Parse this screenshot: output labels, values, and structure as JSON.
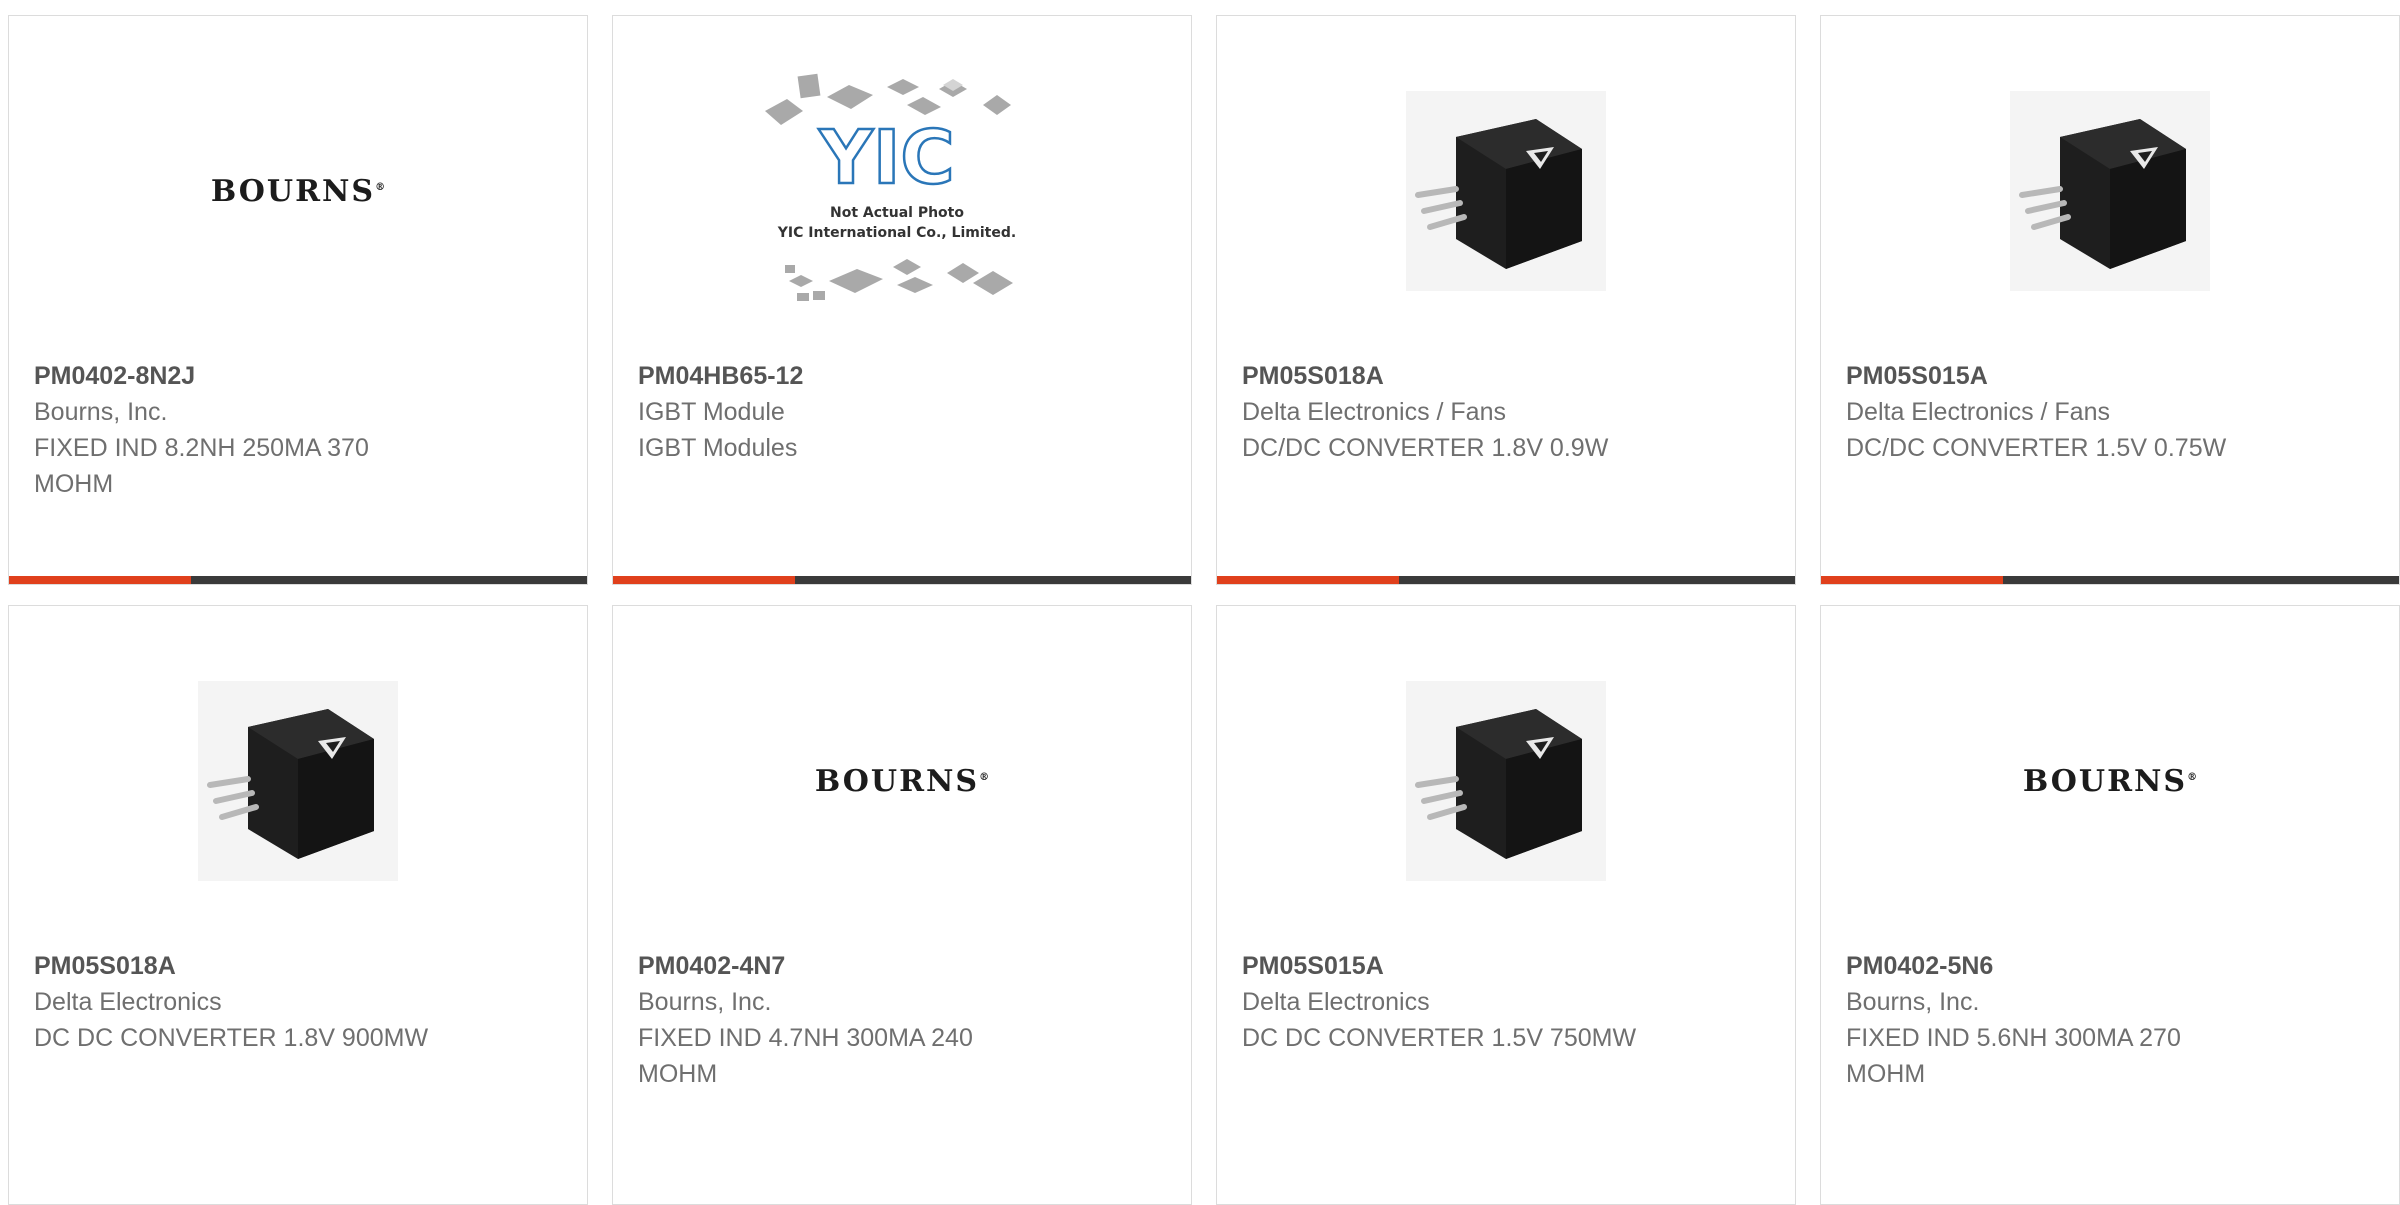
{
  "colors": {
    "accent": "#e0401c",
    "bar": "#3a3a3a",
    "part_text": "#555555",
    "body_text": "#6f6f6f"
  },
  "products": [
    {
      "part": "PM0402-8N2J",
      "maker": "Bourns, Inc.",
      "description": "FIXED IND 8.2NH 250MA 370 MOHM",
      "image": "bourns-logo",
      "logo_text": "BOURNS"
    },
    {
      "part": "PM04HB65-12",
      "maker": "IGBT Module",
      "description": "IGBT Modules",
      "image": "not-actual-photo",
      "placeholder_line1": "Not Actual Photo",
      "placeholder_line2": "YIC International Co., Limited.",
      "placeholder_logo": "YIC"
    },
    {
      "part": "PM05S018A",
      "maker": "Delta Electronics / Fans",
      "description": "DC/DC CONVERTER 1.8V 0.9W",
      "image": "converter-photo"
    },
    {
      "part": "PM05S015A",
      "maker": "Delta Electronics / Fans",
      "description": "DC/DC CONVERTER 1.5V 0.75W",
      "image": "converter-photo"
    },
    {
      "part": "PM05S018A",
      "maker": "Delta Electronics",
      "description": "DC DC CONVERTER 1.8V 900MW",
      "image": "converter-photo"
    },
    {
      "part": "PM0402-4N7",
      "maker": "Bourns, Inc.",
      "description": "FIXED IND 4.7NH 300MA 240 MOHM",
      "image": "bourns-logo",
      "logo_text": "BOURNS"
    },
    {
      "part": "PM05S015A",
      "maker": "Delta Electronics",
      "description": "DC DC CONVERTER 1.5V 750MW",
      "image": "converter-photo"
    },
    {
      "part": "PM0402-5N6",
      "maker": "Bourns, Inc.",
      "description": "FIXED IND 5.6NH 300MA 270 MOHM",
      "image": "bourns-logo",
      "logo_text": "BOURNS"
    }
  ]
}
